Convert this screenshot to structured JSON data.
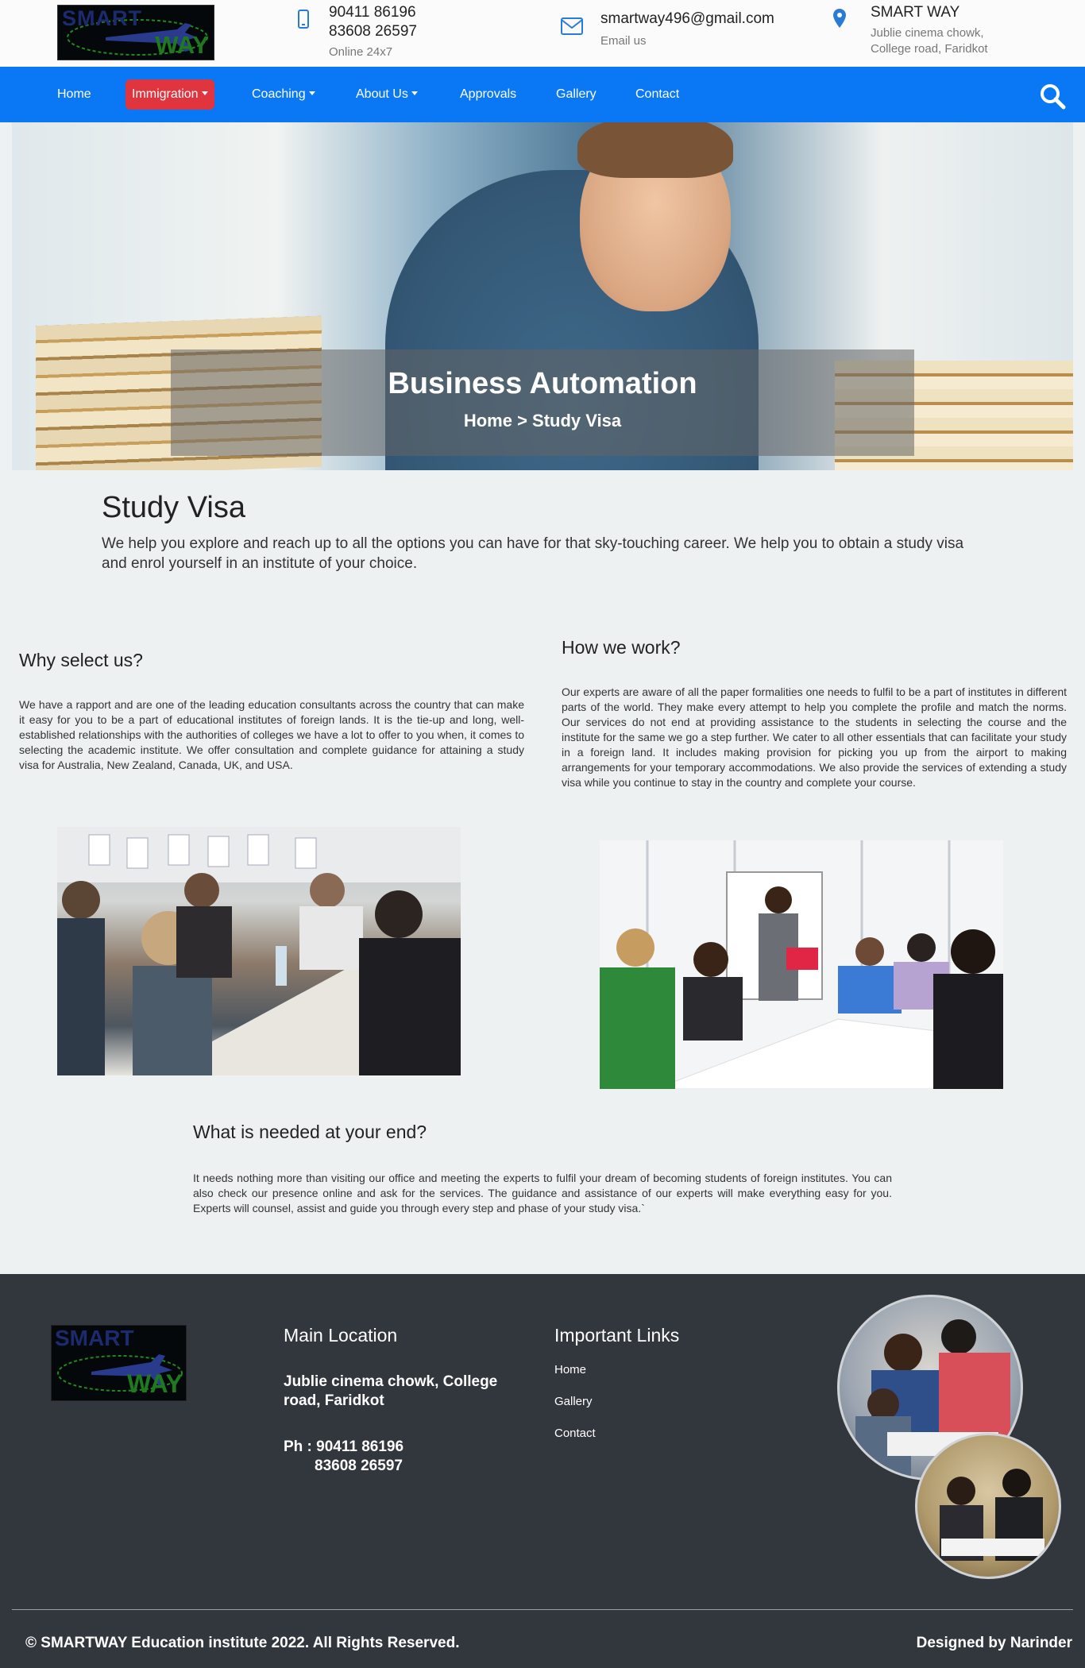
{
  "topbar": {
    "logo_text_top": "SMART",
    "logo_text_bottom": "WAY",
    "phone_1": "90411 86196",
    "phone_2": "83608 26597",
    "phone_sub": "Online 24x7",
    "email": "smartway496@gmail.com",
    "email_sub": "Email us",
    "location_title": "SMART WAY",
    "location_line_1": "Jublie cinema chowk,",
    "location_line_2": "College road, Faridkot"
  },
  "nav": {
    "items": [
      {
        "label": "Home"
      },
      {
        "label": "Immigration"
      },
      {
        "label": "Coaching"
      },
      {
        "label": "About Us"
      },
      {
        "label": "Approvals"
      },
      {
        "label": "Gallery"
      },
      {
        "label": "Contact"
      }
    ],
    "active": "Immigration",
    "accent": "#0a78f5",
    "active_color": "#e0343f"
  },
  "hero": {
    "title": "Business Automation",
    "breadcrumb": "Home > Study Visa"
  },
  "main": {
    "title": "Study Visa",
    "intro": "We help you explore and reach up to all the options you can have for that sky-touching career. We help you to obtain a study visa and enrol yourself in an institute of your choice.",
    "why": {
      "heading": "Why select us?",
      "text": "We have a rapport and are one of the leading education consultants across the country that can make it easy for you to be a part of educational institutes of foreign lands. It is the tie-up and long, well-established relationships with the authorities of colleges we have a lot to offer to you when, it comes to selecting the academic institute. We offer consultation and complete guidance for attaining a study visa for Australia, New Zealand, Canada, UK, and USA."
    },
    "how": {
      "heading": "How we work?",
      "text": "Our experts are aware of all the paper formalities one needs to fulfil to be a part of institutes in different parts of the world. They make every attempt to help you complete the profile and match the norms. Our services do not end at providing assistance to the students in selecting the course and the institute for the same we go a step further. We cater to all other essentials that can facilitate your study in a foreign land. It includes making provision for picking you up from the airport to making arrangements for your temporary accommodations. We also provide the services of extending a study visa while you continue to stay in the country and complete your course."
    },
    "needed": {
      "heading": "What is needed at your end?",
      "text": "It needs nothing more than visiting our office and meeting the experts to fulfil your dream of becoming students of foreign institutes. You can also check our presence online and ask for the services. The guidance and assistance of our experts will make everything easy for you. Experts will counsel, assist and guide you through every step and phase of your study visa.`"
    }
  },
  "footer": {
    "location_heading": "Main Location",
    "address": "Jublie cinema chowk, College road, Faridkot",
    "phone_label": "Ph : 90411 86196",
    "phone_2": "83608 26597",
    "links_heading": "Important Links",
    "links": [
      {
        "label": "Home"
      },
      {
        "label": "Gallery"
      },
      {
        "label": "Contact"
      }
    ],
    "copyright": "© SMARTWAY Education institute 2022. All Rights Reserved.",
    "designer": "Designed by Narinder"
  }
}
